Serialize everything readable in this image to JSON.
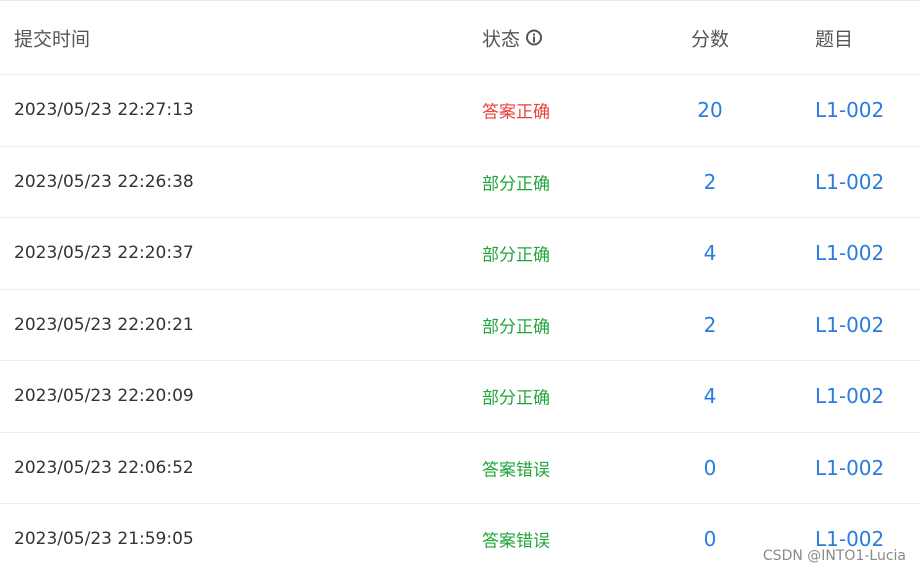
{
  "header": {
    "submit_time": "提交时间",
    "status": "状态",
    "score": "分数",
    "problem": "题目"
  },
  "rows": [
    {
      "time": "2023/05/23 22:27:13",
      "status": "答案正确",
      "status_color": "#e8413b",
      "score": "20",
      "problem": "L1-002"
    },
    {
      "time": "2023/05/23 22:26:38",
      "status": "部分正确",
      "status_color": "#22a63b",
      "score": "2",
      "problem": "L1-002"
    },
    {
      "time": "2023/05/23 22:20:37",
      "status": "部分正确",
      "status_color": "#22a63b",
      "score": "4",
      "problem": "L1-002"
    },
    {
      "time": "2023/05/23 22:20:21",
      "status": "部分正确",
      "status_color": "#22a63b",
      "score": "2",
      "problem": "L1-002"
    },
    {
      "time": "2023/05/23 22:20:09",
      "status": "部分正确",
      "status_color": "#22a63b",
      "score": "4",
      "problem": "L1-002"
    },
    {
      "time": "2023/05/23 22:06:52",
      "status": "答案错误",
      "status_color": "#22a63b",
      "score": "0",
      "problem": "L1-002"
    },
    {
      "time": "2023/05/23 21:59:05",
      "status": "答案错误",
      "status_color": "#22a63b",
      "score": "0",
      "problem": "L1-002"
    }
  ],
  "watermark": "CSDN @INTO1-Lucia",
  "colors": {
    "link": "#2b7be0",
    "header_text": "#555555"
  }
}
